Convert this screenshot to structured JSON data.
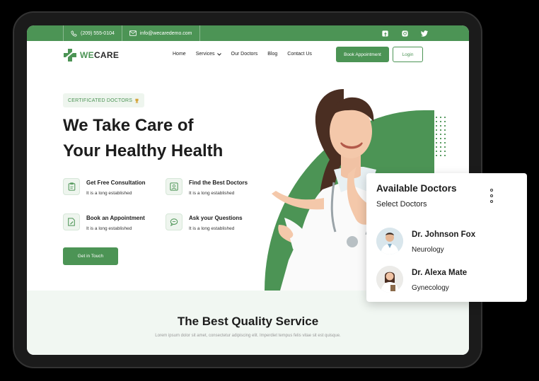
{
  "topbar": {
    "phone": "(209) 555-0104",
    "email": "info@wecaredemo.com"
  },
  "socials": [
    "facebook-icon",
    "instagram-icon",
    "twitter-icon"
  ],
  "logo": {
    "text_a": "WE",
    "text_b": "CARE"
  },
  "nav": {
    "items": [
      "Home",
      "Services",
      "Our Doctors",
      "Blog",
      "Contact Us"
    ],
    "book_label": "Book Appointment",
    "login_label": "Login"
  },
  "hero": {
    "badge": "CERTIFICATED DOCTORS",
    "title_line1": "We Take Care of",
    "title_line2": "Your Healthy Health",
    "features": [
      {
        "title": "Get Free Consultation",
        "desc": "It is a long established"
      },
      {
        "title": "Find the Best Doctors",
        "desc": "It is a long established"
      },
      {
        "title": "Book an Appointment",
        "desc": "It is a long established"
      },
      {
        "title": "Ask your Questions",
        "desc": "It is a long established"
      }
    ],
    "cta_label": "Get in Touch"
  },
  "service": {
    "title": "The Best Quality Service",
    "desc": "Lorem ipsum dolor sit amet, consectetur adipiscing elit. Imperdiet tempus felis vitae sit est quisque."
  },
  "card": {
    "title": "Available Doctors",
    "subtitle": "Select Doctors",
    "doctors": [
      {
        "name": "Dr. Johnson Fox",
        "specialty": "Neurology"
      },
      {
        "name": "Dr. Alexa Mate",
        "specialty": "Gynecology"
      }
    ]
  },
  "colors": {
    "accent": "#4c9455",
    "accent_light": "#eef5ee",
    "service_bg": "#f1f7f2"
  }
}
